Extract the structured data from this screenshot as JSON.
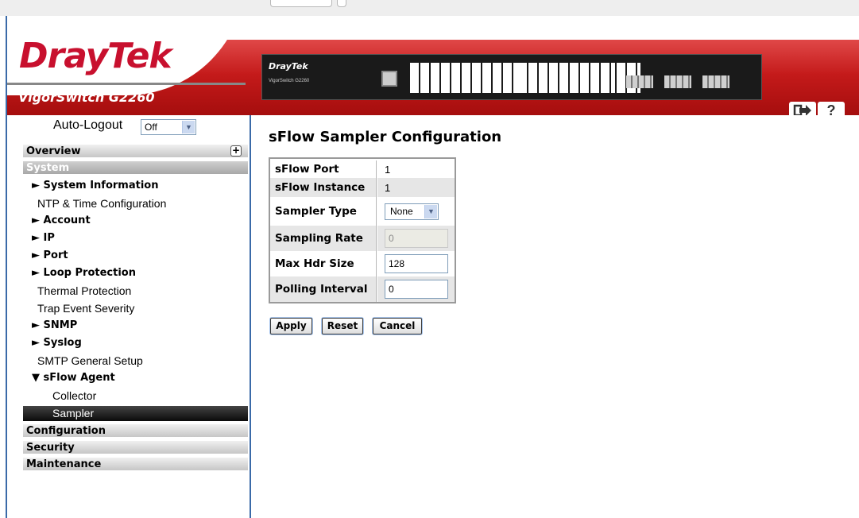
{
  "header": {
    "logo": "DrayTek",
    "model": "VigorSwitch G2260",
    "device_logo": "DrayTek",
    "device_model": "VigorSwitch G2260",
    "logout_icon": "logout-arrow-icon",
    "help_icon": "help-question-icon",
    "help_label": "?"
  },
  "sidebar": {
    "auto_logout_label": "Auto-Logout",
    "auto_logout_value": "Off",
    "categories": {
      "overview": "Overview",
      "system": "System",
      "configuration": "Configuration",
      "security": "Security",
      "maintenance": "Maintenance"
    },
    "items": {
      "system_information": "► System Information",
      "ntp": "NTP & Time Configuration",
      "account": "► Account",
      "ip": "► IP",
      "port": "► Port",
      "loop_protection": "► Loop Protection",
      "thermal_protection": "Thermal Protection",
      "trap_event_severity": "Trap Event Severity",
      "snmp": "► SNMP",
      "syslog": "► Syslog",
      "smtp": "SMTP General Setup",
      "sflow_agent": "▼ sFlow Agent",
      "collector": "Collector",
      "sampler": "Sampler"
    },
    "selected": "Sampler"
  },
  "main": {
    "title": "sFlow Sampler Configuration",
    "rows": {
      "sflow_port": {
        "label": "sFlow Port",
        "value": "1"
      },
      "sflow_instance": {
        "label": "sFlow Instance",
        "value": "1"
      },
      "sampler_type": {
        "label": "Sampler Type",
        "value": "None"
      },
      "sampling_rate": {
        "label": "Sampling Rate",
        "value": "0"
      },
      "max_hdr_size": {
        "label": "Max Hdr Size",
        "value": "128"
      },
      "polling_interval": {
        "label": "Polling Interval",
        "value": "0"
      }
    },
    "buttons": {
      "apply": "Apply",
      "reset": "Reset",
      "cancel": "Cancel"
    }
  },
  "colors": {
    "brand_red": "#c8102e",
    "frame_blue": "#3a6aa8",
    "selected_bg": "#0a0a0a"
  }
}
